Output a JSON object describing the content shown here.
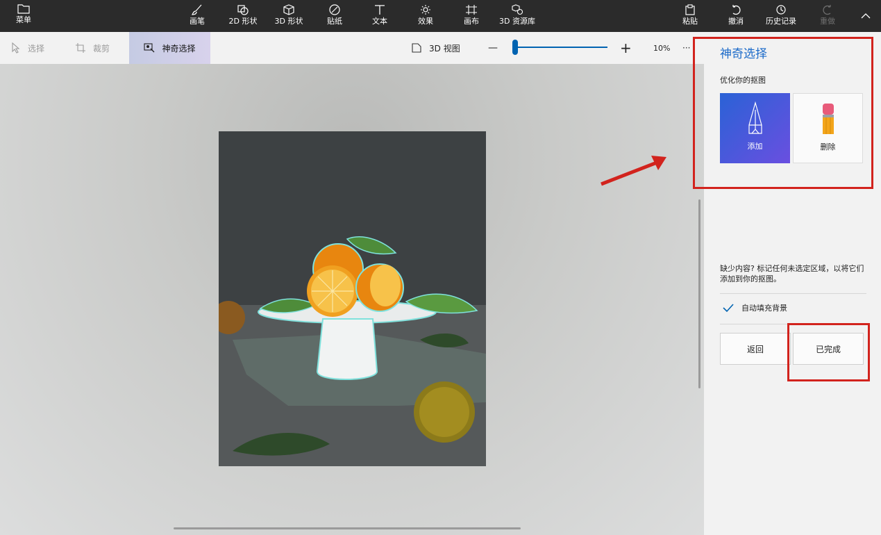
{
  "topbar": {
    "menu_label": "菜单",
    "tools": [
      {
        "label": "画笔",
        "icon": "brush-icon"
      },
      {
        "label": "2D 形状",
        "icon": "2d-shapes-icon"
      },
      {
        "label": "3D 形状",
        "icon": "3d-shapes-icon"
      },
      {
        "label": "贴纸",
        "icon": "stickers-icon"
      },
      {
        "label": "文本",
        "icon": "text-icon"
      },
      {
        "label": "效果",
        "icon": "effects-icon"
      },
      {
        "label": "画布",
        "icon": "canvas-icon"
      },
      {
        "label": "3D 资源库",
        "icon": "3d-library-icon"
      }
    ],
    "actions": [
      {
        "label": "粘贴",
        "icon": "paste-icon"
      },
      {
        "label": "撤消",
        "icon": "undo-icon"
      },
      {
        "label": "历史记录",
        "icon": "history-icon"
      },
      {
        "label": "重做",
        "icon": "redo-icon"
      }
    ]
  },
  "toolbar": {
    "select_label": "选择",
    "crop_label": "裁剪",
    "magic_select_label": "神奇选择",
    "view3d_label": "3D 视图",
    "zoom_minus": "—",
    "zoom_plus": "+",
    "zoom_value": "10%",
    "more": "···"
  },
  "panel": {
    "title": "神奇选择",
    "subtitle": "优化你的抠图",
    "add_label": "添加",
    "remove_label": "删除",
    "hint": "缺少内容? 标记任何未选定区域，以将它们添加到你的抠图。",
    "autofill_label": "自动填充背景",
    "autofill_checked": true,
    "back_label": "返回",
    "done_label": "已完成"
  },
  "colors": {
    "accent": "#0063b1",
    "annotation": "#d2231d",
    "topbar": "#2b2b2b"
  }
}
